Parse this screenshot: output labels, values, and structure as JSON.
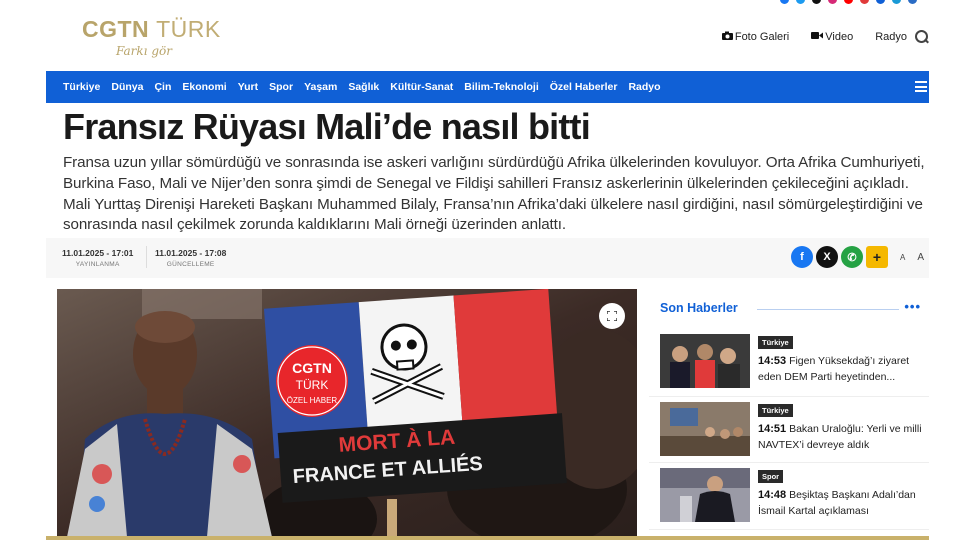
{
  "header": {
    "logo_main": "CGTN",
    "logo_turk": "TÜRK",
    "logo_tagline": "Farkı gör",
    "links": [
      {
        "label": "Foto Galeri",
        "icon": "camera-icon"
      },
      {
        "label": "Video",
        "icon": "video-icon"
      },
      {
        "label": "Radyo",
        "icon": ""
      }
    ]
  },
  "nav": {
    "items": [
      "Türkiye",
      "Dünya",
      "Çin",
      "Ekonomi",
      "Yurt",
      "Spor",
      "Yaşam",
      "Sağlık",
      "Kültür-Sanat",
      "Bilim-Teknoloji",
      "Özel Haberler",
      "Radyo"
    ],
    "color": "#1060d6"
  },
  "article": {
    "title": "Fransız Rüyası Mali’de nasıl bitti",
    "summary": "Fransa uzun yıllar sömürdüğü ve sonrasında ise askeri varlığını sürdürdüğü Afrika ülkelerinden kovuluyor. Orta Afrika Cumhuriyeti, Burkina Faso, Mali ve Nijer’den sonra şimdi de Senegal ve Fildişi sahilleri Fransız askerlerinin ülkelerinden çekileceğini açıkladı. Mali Yurttaş Direnişi Hareketi Başkanı Muhammed Bilaly, Fransa’nın Afrika’daki ülkelere nasıl girdiğini, nasıl sömürgeleştirdiğini ve sonrasında nasıl çekilmek zorunda kaldıklarını Mali örneği üzerinden anlattı.",
    "published_date": "11.01.2025 - 17:01",
    "published_label": "YAYINLANMA",
    "updated_date": "11.01.2025 - 17:08",
    "updated_label": "GÜNCELLEME",
    "share": {
      "facebook": "f",
      "x": "X",
      "whatsapp": "✆",
      "plus": "+",
      "font_small": "A",
      "font_large": "A"
    }
  },
  "hero": {
    "badge_line1": "CGTN",
    "badge_line2": "TÜRK",
    "badge_line3": "ÖZEL HABER",
    "sign_line1": "MORT À LA",
    "sign_line2": "FRANCE ET ALLIÉS",
    "flag_colors": [
      "#2f4fa3",
      "#f4f4f4",
      "#e03a3a"
    ]
  },
  "sidebar": {
    "title": "Son Haberler",
    "more": "•••",
    "items": [
      {
        "category": "Türkiye",
        "time": "14:53",
        "text": "Figen Yüksekdağ’ı ziyaret eden DEM Parti heyetinden..."
      },
      {
        "category": "Türkiye",
        "time": "14:51",
        "text": "Bakan Uraloğlu: Yerli ve milli NAVTEX’i devreye aldık"
      },
      {
        "category": "Spor",
        "time": "14:48",
        "text": "Beşiktaş Başkanı Adalı’dan İsmail Kartal açıklaması"
      }
    ]
  }
}
